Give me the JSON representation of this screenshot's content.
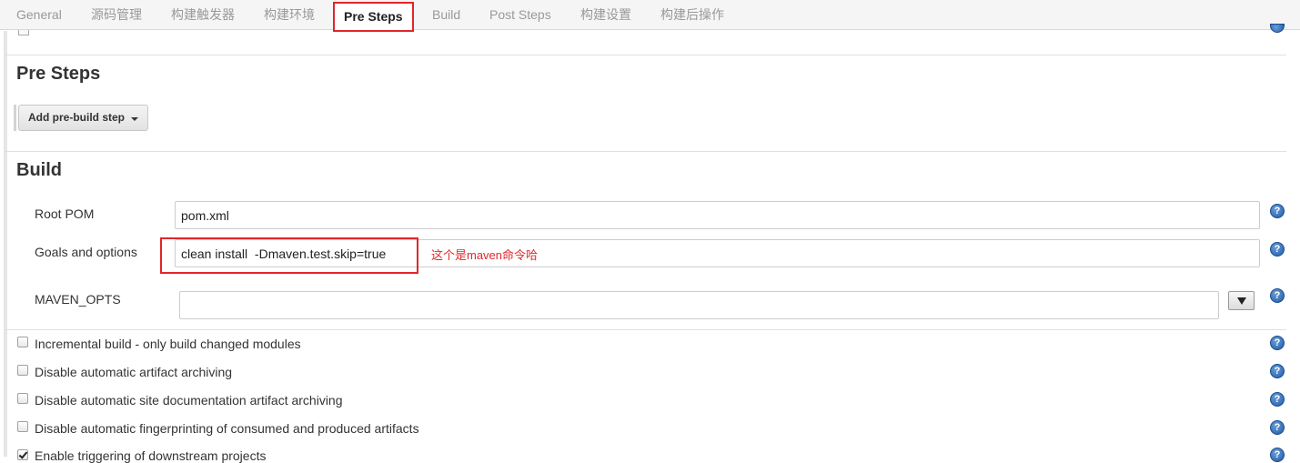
{
  "tabs": [
    {
      "label": "General"
    },
    {
      "label": "源码管理"
    },
    {
      "label": "构建触发器"
    },
    {
      "label": "构建环境"
    },
    {
      "label": "Pre Steps",
      "active": true
    },
    {
      "label": "Build"
    },
    {
      "label": "Post Steps"
    },
    {
      "label": "构建设置"
    },
    {
      "label": "构建后操作"
    }
  ],
  "pre_steps": {
    "title": "Pre Steps",
    "add_button_label": "Add pre-build step"
  },
  "build": {
    "title": "Build",
    "root_pom": {
      "label": "Root POM",
      "value": "pom.xml"
    },
    "goals": {
      "label": "Goals and options",
      "value": "clean install  -Dmaven.test.skip=true"
    },
    "maven_opts": {
      "label": "MAVEN_OPTS",
      "value": ""
    },
    "annotation": "这个是maven命令哈"
  },
  "options": [
    {
      "label": "Incremental build - only build changed modules",
      "checked": false
    },
    {
      "label": "Disable automatic artifact archiving",
      "checked": false
    },
    {
      "label": "Disable automatic site documentation artifact archiving",
      "checked": false
    },
    {
      "label": "Disable automatic fingerprinting of consumed and produced artifacts",
      "checked": false
    },
    {
      "label": "Enable triggering of downstream projects",
      "checked": true
    }
  ],
  "help_glyph": "?",
  "colors": {
    "accent_red": "#e0262b",
    "help_blue": "#1f5aa6"
  }
}
